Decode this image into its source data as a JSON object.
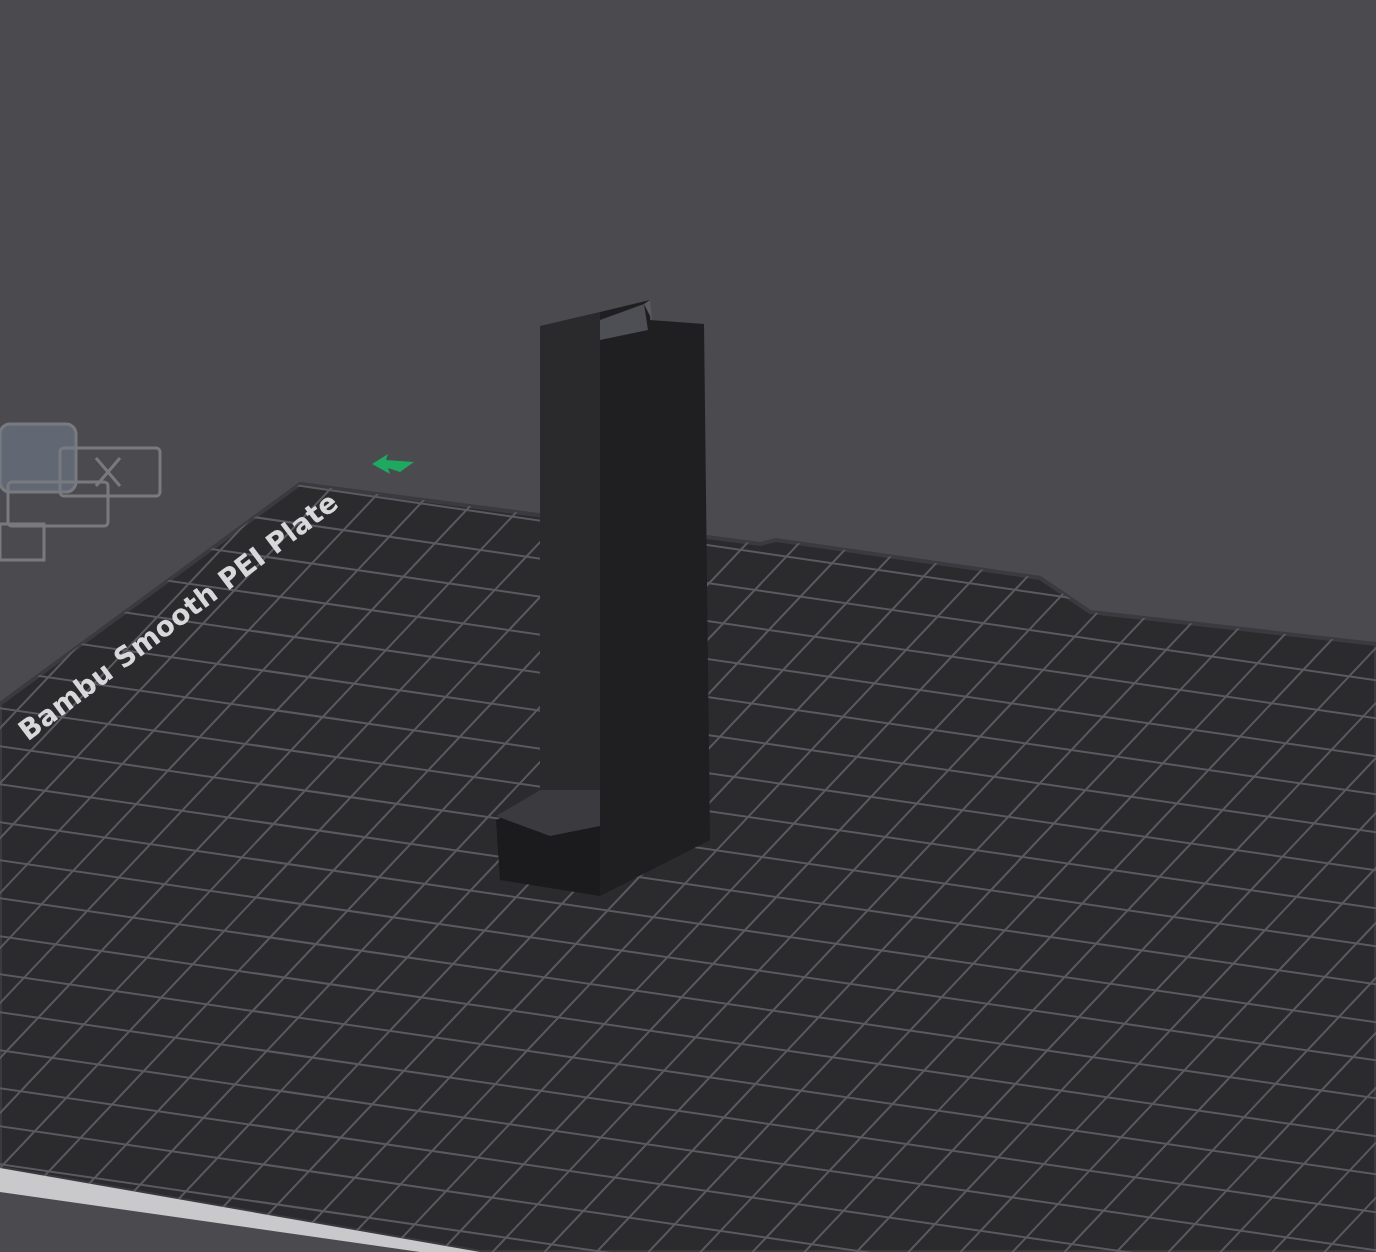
{
  "viewport": {
    "plate_label": "Bambu Smooth PEI Plate"
  }
}
